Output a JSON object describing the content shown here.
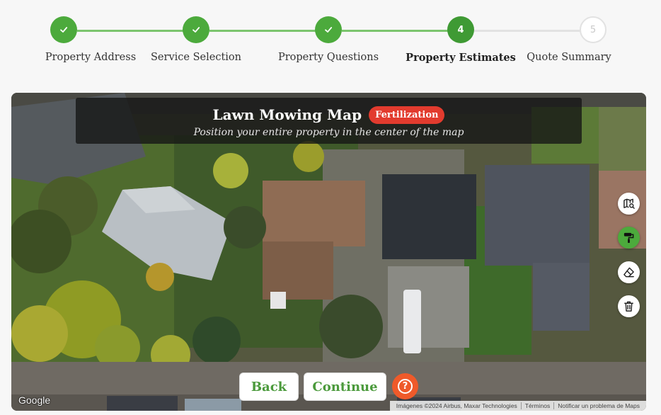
{
  "stepper": {
    "steps": [
      {
        "label": "Property Address",
        "state": "complete",
        "marker": "✓"
      },
      {
        "label": "Service Selection",
        "state": "complete",
        "marker": "✓"
      },
      {
        "label": "Property Questions",
        "state": "complete",
        "marker": "✓"
      },
      {
        "label": "Property Estimates",
        "state": "current",
        "marker": "4"
      },
      {
        "label": "Quote Summary",
        "state": "upcoming",
        "marker": "5"
      }
    ],
    "colors": {
      "complete": "#4caa3c",
      "current": "#3f9a34",
      "upcoming": "#e2e2e2"
    }
  },
  "map": {
    "title": "Lawn Mowing Map",
    "badge": "Fertilization",
    "subtitle": "Position your entire property in the center of the map",
    "tools": [
      {
        "icon": "map-search-icon",
        "active": false
      },
      {
        "icon": "paint-roller-icon",
        "active": true
      },
      {
        "icon": "eraser-icon",
        "active": false
      },
      {
        "icon": "trash-icon",
        "active": false
      }
    ],
    "provider": "Google",
    "attribution": [
      "Imágenes ©2024 Airbus, Maxar Technologies",
      "Términos",
      "Notificar un problema de Maps"
    ]
  },
  "actions": {
    "back": "Back",
    "continue": "Continue",
    "help_icon": "question-circle-icon",
    "help_glyph": "?"
  },
  "colors": {
    "accent": "#4caa3c",
    "badge": "#e23b2e",
    "help": "#ef5a2a"
  }
}
